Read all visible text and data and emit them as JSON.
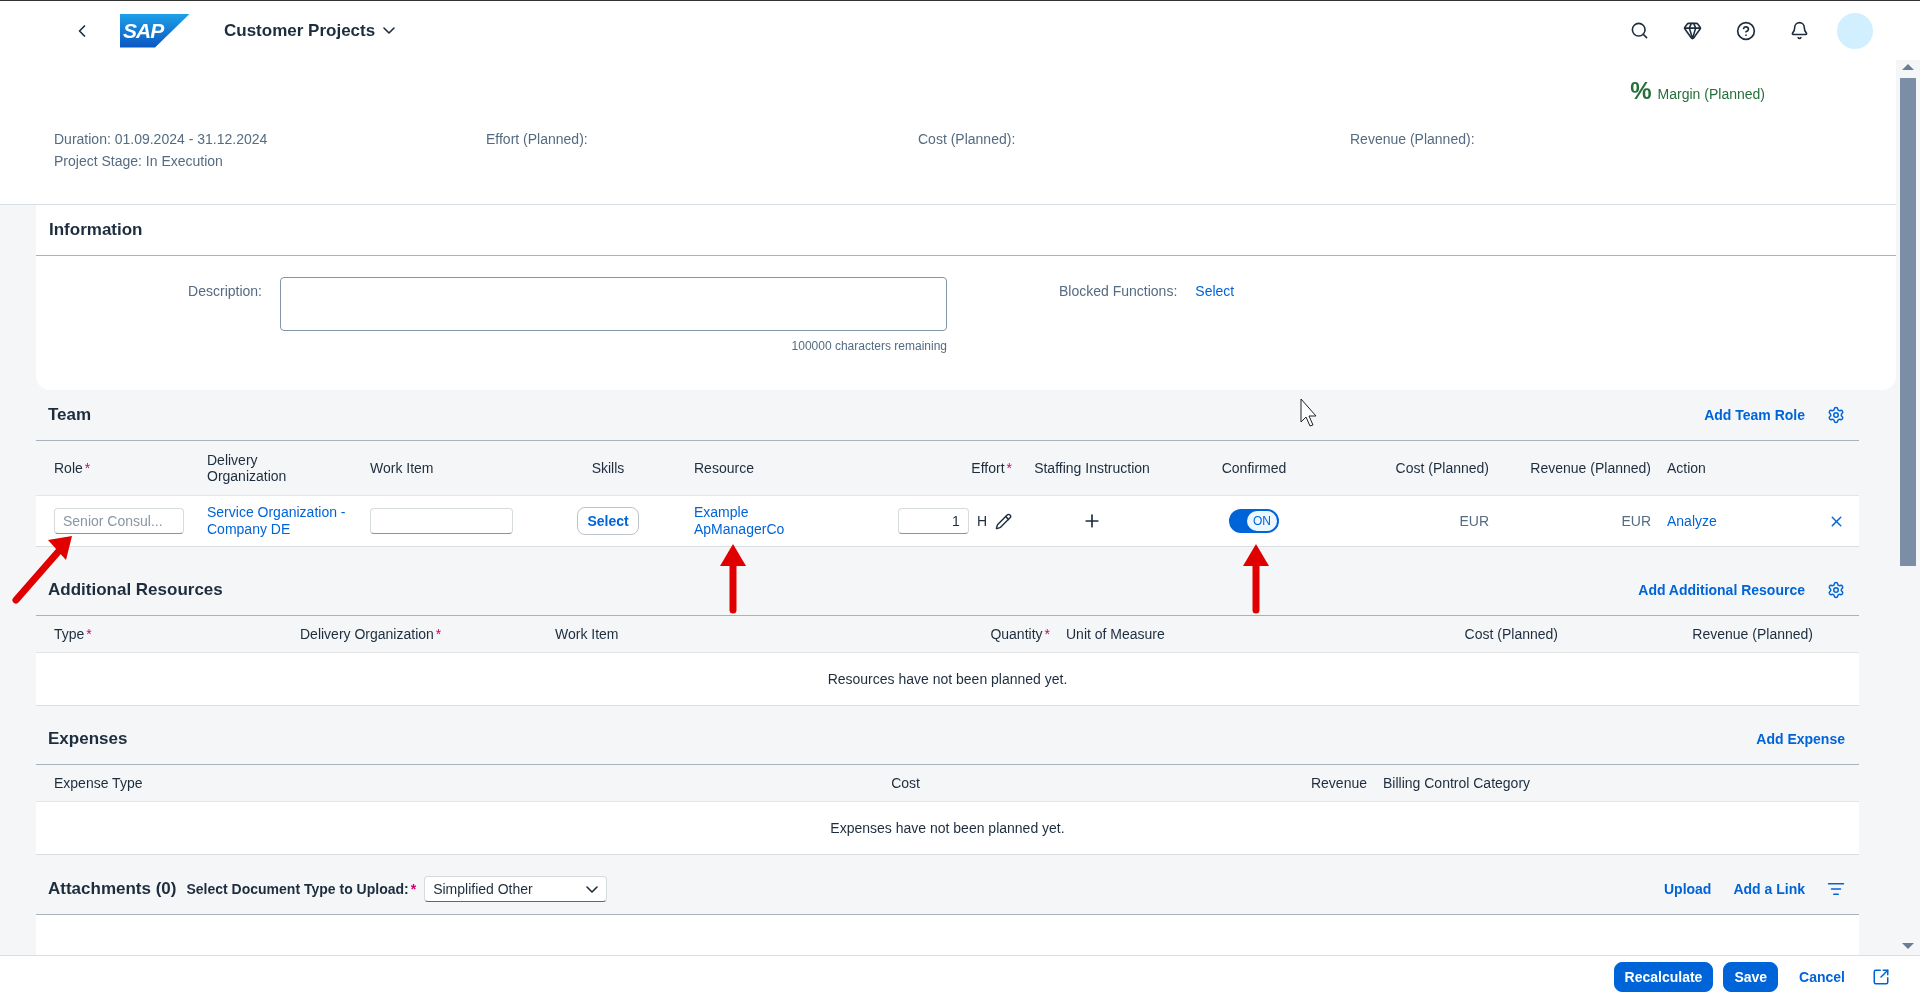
{
  "shell": {
    "logo_text": "SAP",
    "title": "Customer Projects"
  },
  "header": {
    "kpi": {
      "symbol": "%",
      "label": "Margin (Planned)"
    },
    "attribute_columns": [
      {
        "lines": [
          "Duration: 01.09.2024 - 31.12.2024",
          "Project Stage: In Execution"
        ]
      },
      {
        "lines": [
          "Effort (Planned):"
        ]
      },
      {
        "lines": [
          "Cost (Planned):"
        ]
      },
      {
        "lines": [
          "Revenue (Planned):"
        ]
      }
    ]
  },
  "information": {
    "title": "Information",
    "description_label": "Description:",
    "counter": "100000 characters remaining",
    "blocked_label": "Blocked Functions:",
    "blocked_link": "Select"
  },
  "sections": [
    {
      "kind": "team",
      "title": "Team",
      "actions": [
        "Add Team Role"
      ],
      "settings_button": true,
      "columns": [
        {
          "label": "Role",
          "required_mark": "*"
        },
        {
          "label": "Delivery Organization"
        },
        {
          "label": "Work Item"
        },
        {
          "label": "Skills"
        },
        {
          "label": "Resource"
        },
        {
          "label": "Effort",
          "required_mark": "*"
        },
        {
          "label": "Staffing Instruction"
        },
        {
          "label": "Confirmed"
        },
        {
          "label": "Cost (Planned)"
        },
        {
          "label": "Revenue (Planned)"
        },
        {
          "label": "Action"
        }
      ],
      "rows": [
        {
          "role_placeholder": "Senior Consul...",
          "delivery_organization": "Service Organization - Company DE",
          "skills_button": "Select",
          "resource": "Example ApManagerCo",
          "effort": "1",
          "unit": "H",
          "confirmed": {
            "on": true,
            "label": "ON"
          },
          "cost": "EUR",
          "revenue": "EUR",
          "action": "Analyze"
        }
      ]
    },
    {
      "kind": "resources",
      "title": "Additional Resources",
      "actions": [
        "Add Additional Resource"
      ],
      "settings_button": true,
      "columns": [
        {
          "label": "Type",
          "required_mark": "*"
        },
        {
          "label": "Delivery Organization",
          "required_mark": "*"
        },
        {
          "label": "Work Item"
        },
        {
          "label": "Quantity",
          "required_mark": "*"
        },
        {
          "label": "Unit of Measure"
        },
        {
          "label": "Cost (Planned)"
        },
        {
          "label": "Revenue (Planned)"
        }
      ],
      "empty_text": "Resources have not been planned yet."
    },
    {
      "kind": "expenses",
      "title": "Expenses",
      "actions": [
        "Add Expense"
      ],
      "columns": [
        {
          "label": "Expense Type"
        },
        {
          "label": "Cost"
        },
        {
          "label": "Revenue"
        },
        {
          "label": "Billing Control Category"
        }
      ],
      "empty_text": "Expenses have not been planned yet."
    }
  ],
  "attachments": {
    "title": "Attachments (0)",
    "type_label": "Select Document Type to Upload:",
    "required_mark": "*",
    "type_value": "Simplified Other",
    "actions": [
      "Upload",
      "Add a Link"
    ]
  },
  "footer": {
    "buttons": [
      {
        "label": "Recalculate",
        "kind": "emphasized"
      },
      {
        "label": "Save",
        "kind": "emphasized"
      },
      {
        "label": "Cancel",
        "kind": "transparent"
      }
    ]
  }
}
